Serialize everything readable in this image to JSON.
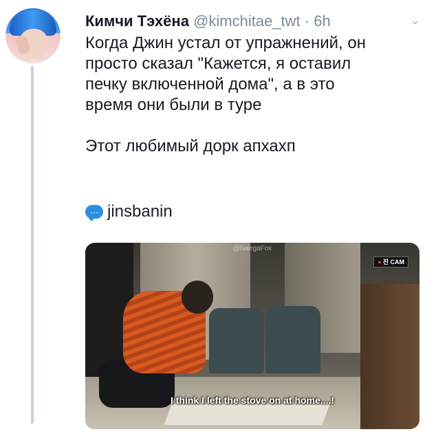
{
  "tweet": {
    "author_name": "Кимчи Тэхёна",
    "author_handle": "@kimchitae_twt",
    "separator": "·",
    "time": "6h",
    "text": "Когда Джин устал от упражнений, он\nпросто сказал \"Кажется, я оставил\nпечку включенной дома\", а в это\nвремя они были в туре\n\nЭтот любимый дорк апхахп",
    "mention": "jinsbanin",
    "mention_icon": "…"
  },
  "media": {
    "watermark": "@NaegaFox",
    "cam_label": "진 CAM",
    "subtitle": "I think I left the stove on at home....!"
  },
  "icons": {
    "menu": "chevron-down-icon",
    "mention": "speech-bubble-icon"
  },
  "colors": {
    "handle": "#7a8a98",
    "mention_icon": "#2b8ee0",
    "thread_line": "#c5d1dc"
  }
}
